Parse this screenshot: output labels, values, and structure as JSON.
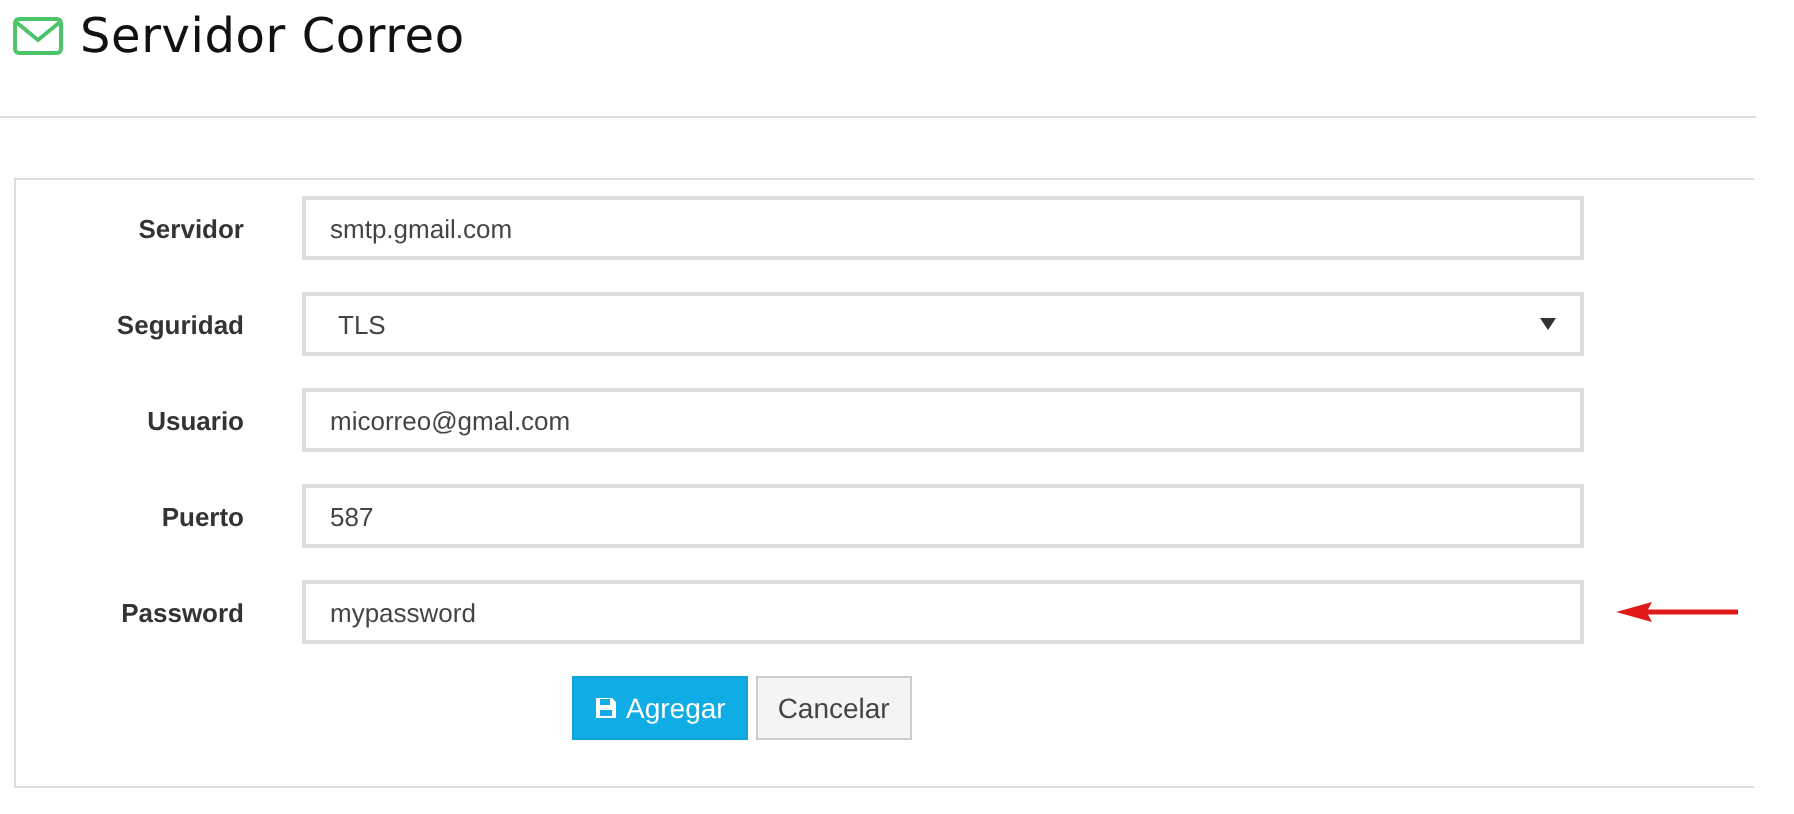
{
  "page": {
    "title": "Servidor Correo"
  },
  "fields": [
    {
      "label": "Servidor",
      "kind": "text",
      "value": "smtp.gmail.com"
    },
    {
      "label": "Seguridad",
      "kind": "select",
      "value": "TLS"
    },
    {
      "label": "Usuario",
      "kind": "text",
      "value": "micorreo@gmal.com"
    },
    {
      "label": "Puerto",
      "kind": "text",
      "value": "587"
    },
    {
      "label": "Password",
      "kind": "text",
      "value": "mypassword"
    }
  ],
  "buttons": [
    {
      "label": "Agregar",
      "kind": "primary"
    },
    {
      "label": "Cancelar",
      "kind": "default"
    }
  ]
}
